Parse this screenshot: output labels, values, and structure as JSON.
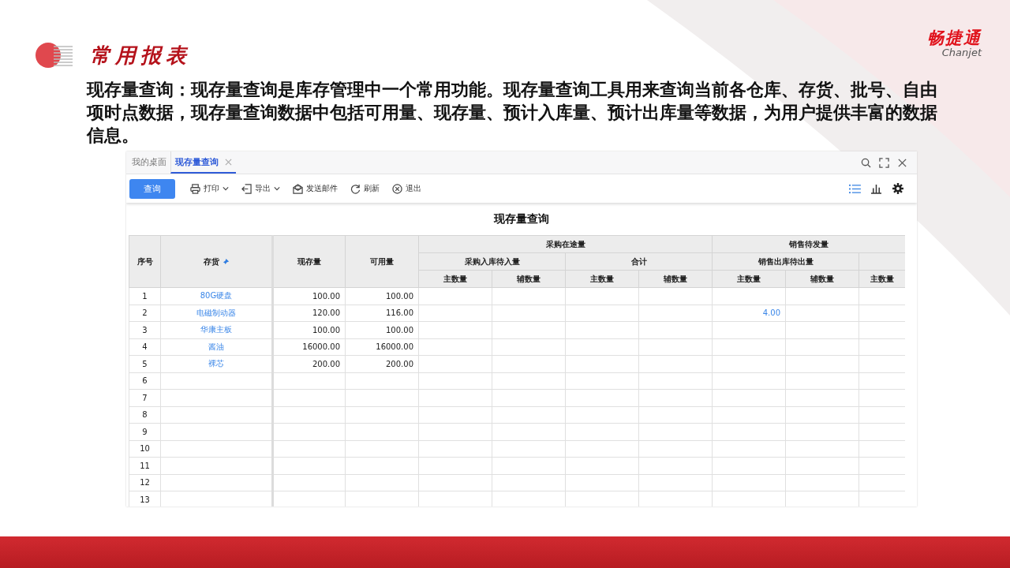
{
  "slide": {
    "title": "常用报表",
    "brand": "畅捷通",
    "brand_latin": "Chanjet",
    "description": "现存量查询：现存量查询是库存管理中一个常用功能。现存量查询工具用来查询当前各仓库、存货、批号、自由项时点数据，现存量查询数据中包括可用量、现存量、预计入库量、预计出库量等数据，为用户提供丰富的数据信息。"
  },
  "tabs": [
    {
      "label": "我的桌面",
      "selected": false,
      "closable": false
    },
    {
      "label": "现存量查询",
      "selected": true,
      "closable": true
    }
  ],
  "toolbar": {
    "primary": "查询",
    "buttons": [
      {
        "label": "打印",
        "kind": "print",
        "dropdown": true
      },
      {
        "label": "导出",
        "kind": "export",
        "dropdown": true
      },
      {
        "label": "发送邮件",
        "kind": "mail",
        "dropdown": false
      },
      {
        "label": "刷新",
        "kind": "refresh",
        "dropdown": false
      },
      {
        "label": "退出",
        "kind": "exit",
        "dropdown": false
      }
    ],
    "view": [
      {
        "kind": "list",
        "selected": true
      },
      {
        "kind": "chart",
        "selected": false
      }
    ]
  },
  "report": {
    "title": "现存量查询",
    "columns": [
      "序号",
      "存货",
      "现存量",
      "可用量"
    ],
    "groups": [
      {
        "label": "采购在途量",
        "subgroups": [
          {
            "label": "采购入库待入量",
            "columns": [
              "主数量",
              "辅数量"
            ]
          },
          {
            "label": "合计",
            "columns": [
              "主数量",
              "辅数量"
            ]
          }
        ]
      },
      {
        "label": "销售待发量",
        "subgroups": [
          {
            "label": "销售出库待出量",
            "columns": [
              "主数量",
              "辅数量"
            ]
          },
          {
            "columns": [
              "主数量"
            ]
          }
        ]
      }
    ],
    "rows": [
      {
        "no": "1",
        "item": "80G硬盘",
        "on_hand": "100.00",
        "available": "100.00"
      },
      {
        "no": "2",
        "item": "电磁制动器",
        "on_hand": "120.00",
        "available": "116.00",
        "sales_outbound_pending_main": "4.00"
      },
      {
        "no": "3",
        "item": "华康主板",
        "on_hand": "100.00",
        "available": "100.00"
      },
      {
        "no": "4",
        "item": "酱油",
        "on_hand": "16000.00",
        "available": "16000.00"
      },
      {
        "no": "5",
        "item": "裸芯",
        "on_hand": "200.00",
        "available": "200.00"
      },
      {
        "no": "6"
      },
      {
        "no": "7"
      },
      {
        "no": "8"
      },
      {
        "no": "9"
      },
      {
        "no": "10"
      },
      {
        "no": "11"
      },
      {
        "no": "12"
      },
      {
        "no": "13"
      }
    ]
  }
}
